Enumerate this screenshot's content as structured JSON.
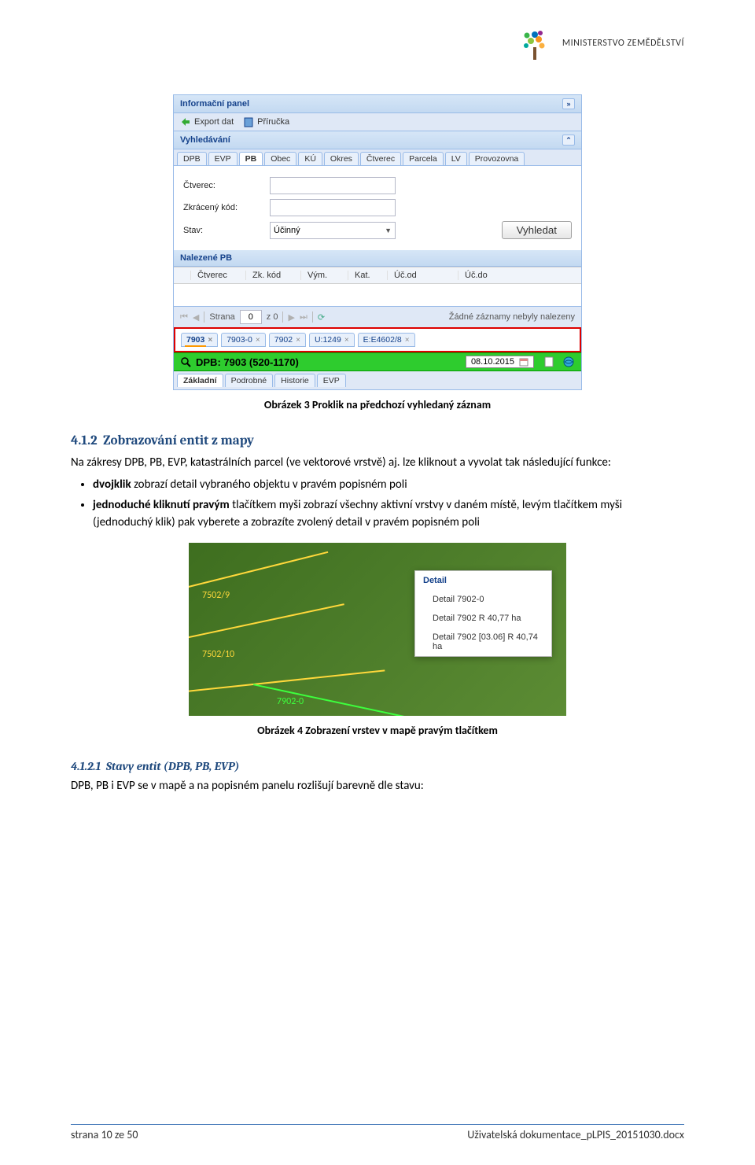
{
  "header": {
    "ministry": "MINISTERSTVO ZEMĚDĚLSTVÍ"
  },
  "screenshot1": {
    "infoPanel": "Informační panel",
    "exportDat": "Export dat",
    "prirucka": "Příručka",
    "vyhledavani": "Vyhledávání",
    "searchTabs": [
      "DPB",
      "EVP",
      "PB",
      "Obec",
      "KÚ",
      "Okres",
      "Čtverec",
      "Parcela",
      "LV",
      "Provozovna"
    ],
    "activeSearchTab": "PB",
    "fields": {
      "ctverec": "Čtverec:",
      "zkracenyKod": "Zkrácený kód:",
      "stav": "Stav:",
      "stavValue": "Účinný"
    },
    "vyhledatBtn": "Vyhledat",
    "nalezene": "Nalezené PB",
    "gridCols": [
      "",
      "Čtverec",
      "Zk. kód",
      "Vým.",
      "Kat.",
      "Úč.od",
      "Úč.do"
    ],
    "paging": {
      "strana": "Strana",
      "page": "0",
      "zLabel": "z 0",
      "noRecords": "Žádné záznamy nebyly nalezeny"
    },
    "tags": [
      "7903",
      "7903-0",
      "7902",
      "U:1249",
      "E:E4602/8"
    ],
    "dpbTitle": "DPB: 7903 (520-1170)",
    "dpbDate": "08.10.2015",
    "bottomTabs": [
      "Základní",
      "Podrobné",
      "Historie",
      "EVP"
    ]
  },
  "caption1": "Obrázek 3 Proklik na předchozí vyhledaný záznam",
  "section": {
    "num": "4.1.2",
    "title": "Zobrazování entit z mapy",
    "intro": "Na zákresy DPB, PB, EVP, katastrálních parcel (ve vektorové vrstvě) aj. lze kliknout a vyvolat tak následující funkce:",
    "bullet1a": "dvojklik",
    "bullet1b": " zobrazí detail vybraného objektu v pravém popisném poli",
    "bullet2a": "jednoduché kliknutí pravým",
    "bullet2b": " tlačítkem myši zobrazí všechny aktivní vrstvy v daném místě, levým tlačítkem myši (jednoduchý klik) pak vyberete a zobrazíte zvolený detail v pravém popisném poli"
  },
  "mapShot": {
    "label1": "7502/9",
    "label2": "7502/10",
    "label3": "7902-0",
    "menuTitle": "Detail",
    "menuItems": [
      "Detail 7902-0",
      "Detail 7902 R 40,77 ha",
      "Detail 7902 [03.06] R 40,74 ha"
    ]
  },
  "caption2": "Obrázek 4 Zobrazení vrstev v mapě pravým tlačítkem",
  "subsection": {
    "num": "4.1.2.1",
    "title": "Stavy entit (DPB, PB, EVP)",
    "text": "DPB, PB i EVP se v mapě a na popisném panelu rozlišují barevně dle stavu:"
  },
  "footer": {
    "left": "strana 10 ze 50",
    "right": "Uživatelská dokumentace_pLPIS_20151030.docx"
  }
}
